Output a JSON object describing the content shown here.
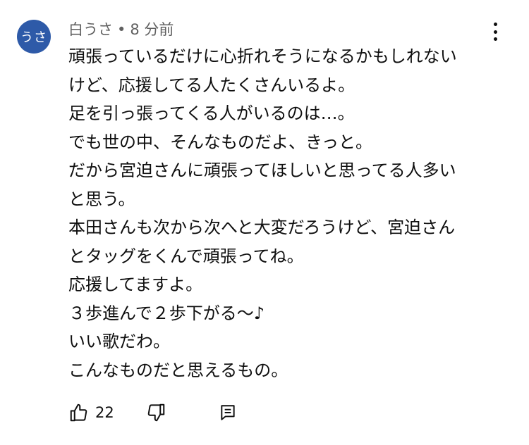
{
  "comment": {
    "avatar_text": "うさ",
    "author": "白うさ",
    "separator": "•",
    "time": "8 分前",
    "lines": [
      "頑張っているだけに心折れそうになるかもしれない",
      "けど、応援してる人たくさんいるよ。",
      "足を引っ張ってくる人がいるのは…。",
      "でも世の中、そんなものだよ、きっと。",
      "だから宮迫さんに頑張ってほしいと思ってる人多い",
      "と思う。",
      "本田さんも次から次へと大変だろうけど、宮迫さん",
      "とタッグをくんで頑張ってね。",
      "応援してますよ。",
      "３歩進んで２歩下がる〜♪",
      "いい歌だわ。",
      "こんなものだと思えるもの。"
    ],
    "like_count": "22"
  },
  "icons": {
    "more": "more-vert-icon",
    "like": "thumb-up-icon",
    "dislike": "thumb-down-icon",
    "reply": "reply-icon"
  },
  "colors": {
    "avatar_bg": "#2e5aa8",
    "meta_text": "#606060",
    "text": "#0f0f0f"
  }
}
